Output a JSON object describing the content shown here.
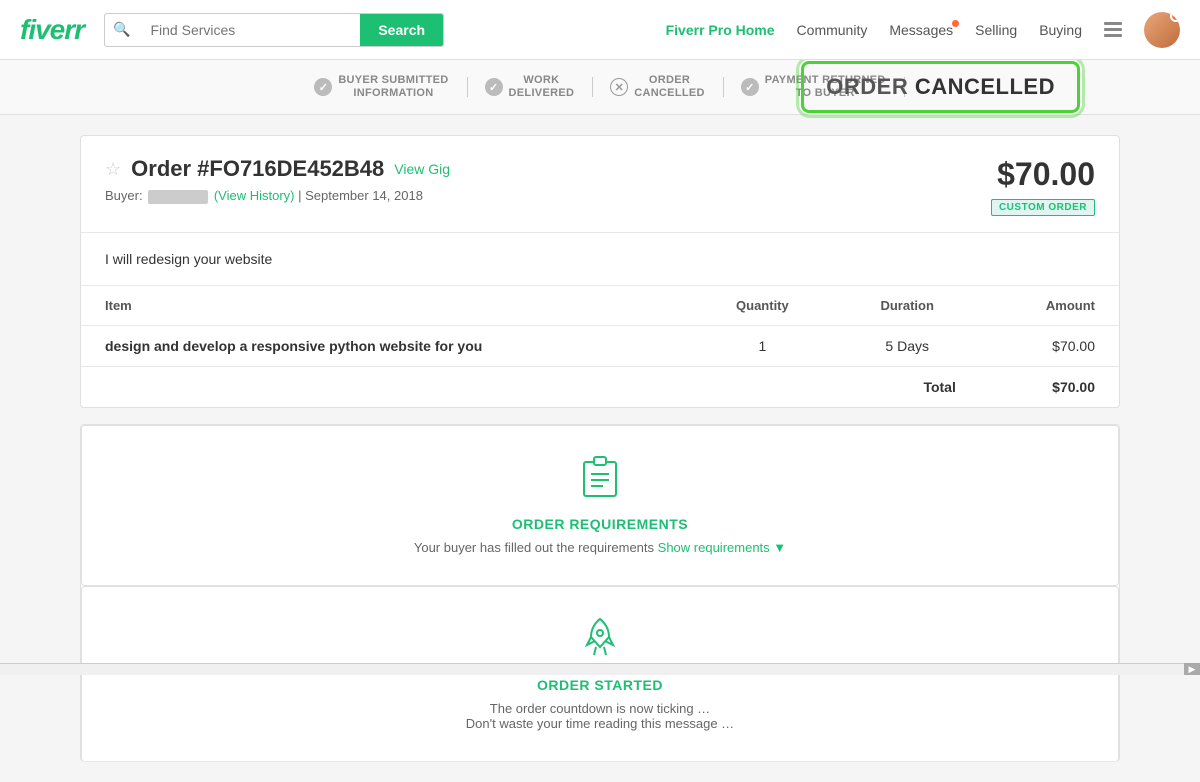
{
  "header": {
    "logo": "fiverr",
    "search_placeholder": "Find Services",
    "search_button": "Search",
    "nav": {
      "pro_home": "Fiverr Pro Home",
      "community": "Community",
      "messages": "Messages",
      "selling": "Selling",
      "buying": "Buying"
    }
  },
  "status_bar": {
    "steps": [
      {
        "id": "step1",
        "label1": "BUYER SUBMITTED",
        "label2": "INFORMATION",
        "icon": "✓",
        "type": "check"
      },
      {
        "id": "step2",
        "label1": "WORK",
        "label2": "DELIVERED",
        "icon": "✓",
        "type": "check"
      },
      {
        "id": "step3",
        "label1": "ORDER",
        "label2": "CANCELLED",
        "icon": "✕",
        "type": "x"
      },
      {
        "id": "step4",
        "label1": "PAYMENT RETURNED",
        "label2": "TO BUYER",
        "icon": "✓",
        "type": "check"
      }
    ],
    "cancelled_label": "ORDER",
    "cancelled_bold": "CANCELLED"
  },
  "order": {
    "order_number": "Order #FO716DE452B48",
    "view_gig": "View Gig",
    "buyer_label": "Buyer:",
    "buyer_history": "(View History)",
    "date": "September 14, 2018",
    "price": "$70.00",
    "custom_badge": "CUSTOM ORDER",
    "description": "I will redesign your website",
    "table": {
      "headers": [
        "Item",
        "Quantity",
        "Duration",
        "Amount"
      ],
      "rows": [
        {
          "item": "design and develop a responsive python website for you",
          "quantity": "1",
          "duration": "5 Days",
          "amount": "$70.00"
        }
      ],
      "total_label": "Total",
      "total_amount": "$70.00"
    }
  },
  "sections": {
    "requirements": {
      "title": "ORDER REQUIREMENTS",
      "description": "Your buyer has filled out the requirements",
      "show_link": "Show requirements ▼"
    },
    "started": {
      "title": "ORDER STARTED",
      "line1": "The order countdown is now ticking …",
      "line2": "Don't waste your time reading this message …"
    }
  }
}
